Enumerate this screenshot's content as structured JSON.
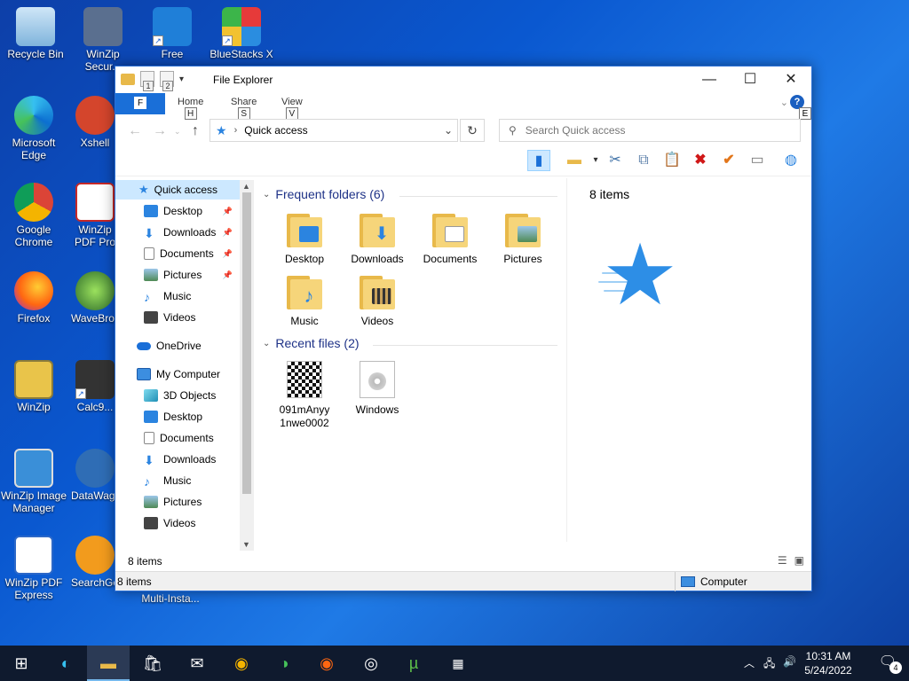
{
  "desktop": {
    "icons": [
      {
        "label": "Recycle Bin"
      },
      {
        "label": "WinZip Secur..."
      },
      {
        "label": "Free"
      },
      {
        "label": "BlueStacks X"
      },
      {
        "label": "Microsoft Edge"
      },
      {
        "label": "Xshell"
      },
      {
        "label": "Google Chrome"
      },
      {
        "label": "WinZip PDF Pro"
      },
      {
        "label": "Firefox"
      },
      {
        "label": "WaveBrow..."
      },
      {
        "label": "WinZip"
      },
      {
        "label": "Calc9..."
      },
      {
        "label": "WinZip Image Manager"
      },
      {
        "label": "DataWag..."
      },
      {
        "label": "WinZip PDF Express"
      },
      {
        "label": "SearchGe..."
      },
      {
        "label": "Multi-Insta..."
      }
    ]
  },
  "window": {
    "title": "File Explorer",
    "qat_keytips": [
      "1",
      "2"
    ],
    "ribbon": {
      "file_keytip": "F",
      "tabs": [
        {
          "label": "Home",
          "keytip": "H"
        },
        {
          "label": "Share",
          "keytip": "S"
        },
        {
          "label": "View",
          "keytip": "V"
        }
      ],
      "help_keytip": "E"
    },
    "address": {
      "path": "Quick access"
    },
    "search": {
      "placeholder": "Search Quick access"
    },
    "nav": {
      "items": [
        {
          "label": "Quick access",
          "selected": true
        },
        {
          "label": "Desktop",
          "pinned": true
        },
        {
          "label": "Downloads",
          "pinned": true
        },
        {
          "label": "Documents",
          "pinned": true
        },
        {
          "label": "Pictures",
          "pinned": true
        },
        {
          "label": "Music"
        },
        {
          "label": "Videos"
        },
        {
          "label": "OneDrive"
        },
        {
          "label": "My Computer"
        },
        {
          "label": "3D Objects"
        },
        {
          "label": "Desktop"
        },
        {
          "label": "Documents"
        },
        {
          "label": "Downloads"
        },
        {
          "label": "Music"
        },
        {
          "label": "Pictures"
        },
        {
          "label": "Videos"
        }
      ]
    },
    "content": {
      "frequent_header": "Frequent folders (6)",
      "frequent": [
        {
          "label": "Desktop"
        },
        {
          "label": "Downloads"
        },
        {
          "label": "Documents"
        },
        {
          "label": "Pictures"
        },
        {
          "label": "Music"
        },
        {
          "label": "Videos"
        }
      ],
      "recent_header": "Recent files (2)",
      "recent": [
        {
          "label": "091mAnyy1nwe0002"
        },
        {
          "label": "Windows"
        }
      ]
    },
    "preview": {
      "count": "8 items"
    },
    "inner_status": "8 items",
    "statusbar": {
      "count": "8 items",
      "location": "Computer"
    }
  },
  "taskbar": {
    "time": "10:31 AM",
    "date": "5/24/2022",
    "notifications": "4"
  },
  "colors": {
    "accent": "#1a6fd8",
    "selection": "#cce8ff",
    "taskbar": "#0f1a2e"
  }
}
